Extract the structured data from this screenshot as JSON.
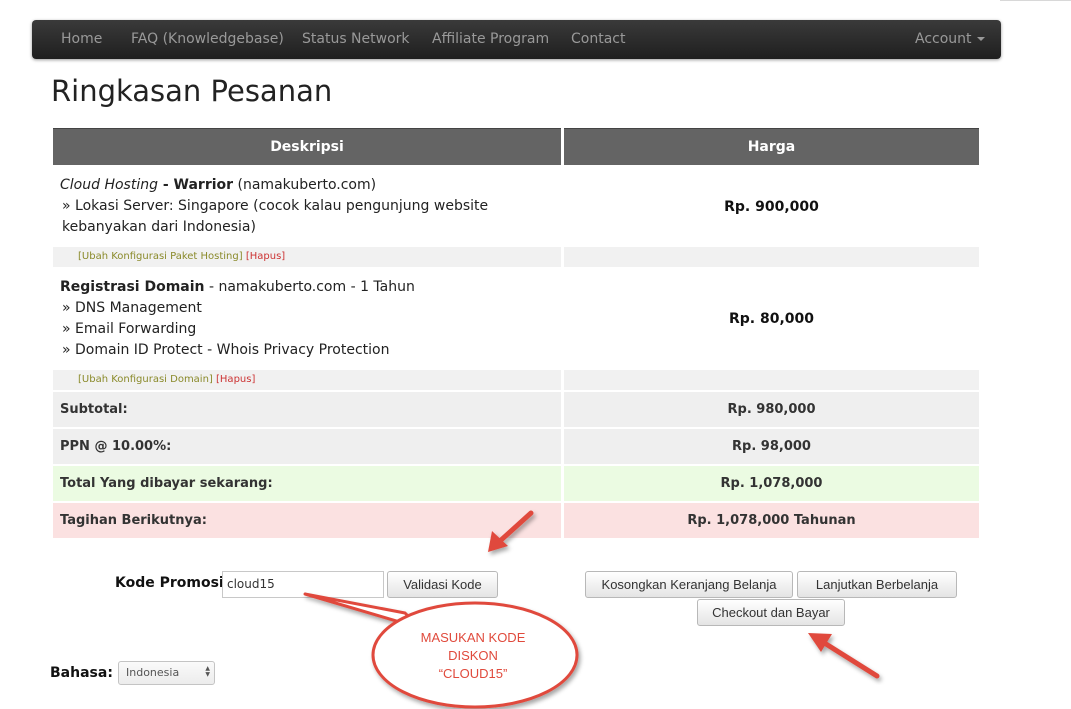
{
  "nav": {
    "items": [
      "Home",
      "FAQ (Knowledgebase)",
      "Status Network",
      "Affiliate Program",
      "Contact"
    ],
    "account": "Account"
  },
  "page_title": "Ringkasan Pesanan",
  "table": {
    "headers": {
      "desc": "Deskripsi",
      "price": "Harga"
    },
    "hosting": {
      "type": "Cloud Hosting",
      "sep": " - ",
      "plan": "Warrior",
      "domain": " (namakuberto.com)",
      "detail": "» Lokasi Server: Singapore (cocok kalau pengunjung website kebanyakan dari Indonesia)",
      "price": "Rp. 900,000",
      "edit_link": "[Ubah Konfigurasi Paket Hosting]",
      "remove_link": "[Hapus]"
    },
    "domain_reg": {
      "title": "Registrasi Domain",
      "info": " - namakuberto.com - 1 Tahun",
      "features": [
        "» DNS Management",
        "» Email Forwarding",
        "» Domain ID Protect - Whois Privacy Protection"
      ],
      "price": "Rp. 80,000",
      "edit_link": "[Ubah Konfigurasi Domain]",
      "remove_link": "[Hapus]"
    },
    "subtotal": {
      "label": "Subtotal:",
      "value": "Rp. 980,000"
    },
    "tax": {
      "label": "PPN @ 10.00%:",
      "value": "Rp. 98,000"
    },
    "total": {
      "label": "Total Yang dibayar sekarang:",
      "value": "Rp. 1,078,000"
    },
    "recurring": {
      "label": "Tagihan Berikutnya:",
      "value": "Rp. 1,078,000 Tahunan"
    }
  },
  "promo": {
    "label": "Kode Promosi",
    "value": "cloud15",
    "validate_button": "Validasi Kode"
  },
  "cart_buttons": {
    "empty": "Kosongkan Keranjang Belanja",
    "continue": "Lanjutkan Berbelanja",
    "checkout": "Checkout dan Bayar"
  },
  "language": {
    "label": "Bahasa:",
    "selected": "Indonesia"
  },
  "annotation": {
    "lines": [
      "MASUKAN KODE",
      "DISKON",
      "“CLOUD15”"
    ],
    "color": "#e04a3c"
  }
}
